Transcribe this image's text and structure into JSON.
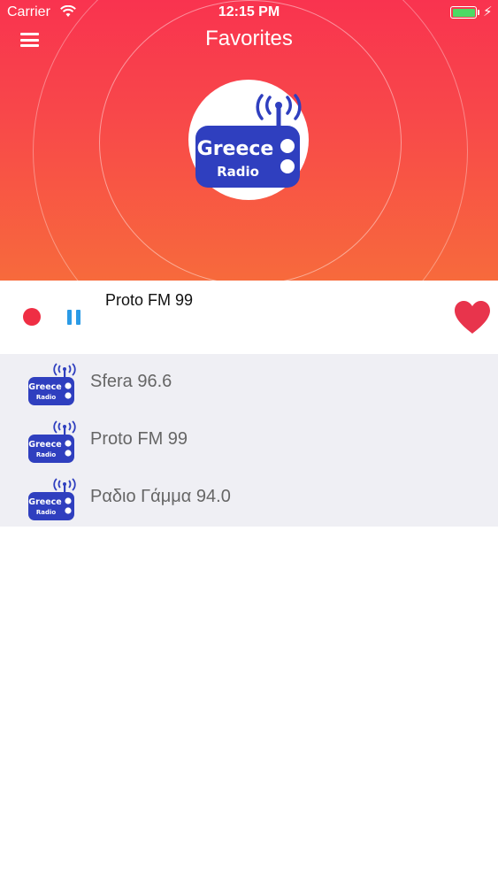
{
  "status_bar": {
    "carrier": "Carrier",
    "time": "12:15 PM"
  },
  "nav": {
    "title": "Favorites"
  },
  "logo": {
    "line1": "Greece",
    "line2": "Radio"
  },
  "player": {
    "now_playing": "Proto FM 99",
    "state": "playing"
  },
  "favorites": [
    {
      "name": "Sfera 96.6",
      "logo_line1": "Greece",
      "logo_line2": "Radio"
    },
    {
      "name": "Proto FM 99",
      "logo_line1": "Greece",
      "logo_line2": "Radio"
    },
    {
      "name": "Ραδιο Γάμμα 94.0",
      "logo_line1": "Greece",
      "logo_line2": "Radio"
    }
  ],
  "colors": {
    "gradient_top": "#f9334f",
    "gradient_bottom": "#f76a3c",
    "record": "#ef2e44",
    "pause": "#2b9be6",
    "heart": "#e8344c",
    "logo_blue": "#2f3fbf",
    "list_bg": "#efeff4"
  },
  "icons": [
    "menu-icon",
    "wifi-icon",
    "battery-icon",
    "charging-bolt-icon",
    "record-icon",
    "pause-icon",
    "heart-icon",
    "radio-logo-icon"
  ]
}
